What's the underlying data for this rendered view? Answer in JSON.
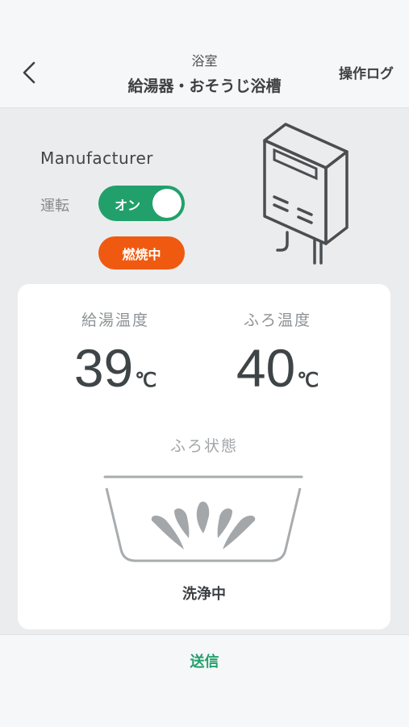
{
  "header": {
    "subtitle": "浴室",
    "title": "給湯器・おそうじ浴槽",
    "log_label": "操作ログ"
  },
  "device": {
    "manufacturer": "Manufacturer",
    "run_label": "運転",
    "toggle_label": "オン",
    "toggle_on": true,
    "status_badge": "燃焼中"
  },
  "card": {
    "hot_water": {
      "label": "給湯温度",
      "value": "39",
      "unit": "℃"
    },
    "bath": {
      "label": "ふろ温度",
      "value": "40",
      "unit": "℃"
    },
    "bath_state_label": "ふろ状態",
    "bath_state": "洗浄中"
  },
  "footer": {
    "send_label": "送信"
  },
  "colors": {
    "accent": "#22a06b",
    "burning": "#ef5a10",
    "background": "#ebecee"
  }
}
